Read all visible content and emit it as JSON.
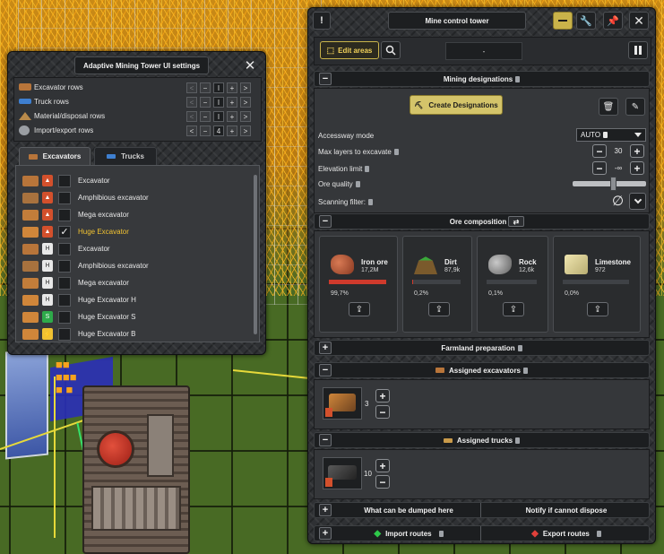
{
  "settings_panel": {
    "title": "Adaptive Mining Tower UI settings",
    "rows": [
      {
        "label": "Excavator rows",
        "value": "I"
      },
      {
        "label": "Truck rows",
        "value": "I"
      },
      {
        "label": "Material/disposal rows",
        "value": "I"
      },
      {
        "label": "Import/export rows",
        "value": "4"
      }
    ],
    "tabs": [
      {
        "label": "Excavators",
        "active": true
      },
      {
        "label": "Trucks",
        "active": false
      }
    ],
    "vehicles": [
      {
        "name": "Excavator",
        "checked": false,
        "fuel": "diesel",
        "selected": false
      },
      {
        "name": "Amphibious excavator",
        "checked": false,
        "fuel": "diesel",
        "selected": false
      },
      {
        "name": "Mega excavator",
        "checked": false,
        "fuel": "diesel",
        "selected": false
      },
      {
        "name": "Huge Excavator",
        "checked": true,
        "fuel": "diesel",
        "selected": true
      },
      {
        "name": "Excavator",
        "checked": false,
        "fuel": "hydrogen",
        "selected": false
      },
      {
        "name": "Amphibious excavator",
        "checked": false,
        "fuel": "hydrogen",
        "selected": false
      },
      {
        "name": "Mega excavator",
        "checked": false,
        "fuel": "hydrogen",
        "selected": false
      },
      {
        "name": "Huge Excavator H",
        "checked": false,
        "fuel": "hydrogen",
        "selected": false
      },
      {
        "name": "Huge Excavator S",
        "checked": false,
        "fuel": "green",
        "selected": false
      },
      {
        "name": "Huge Excavator B",
        "checked": false,
        "fuel": "battery",
        "selected": false
      }
    ]
  },
  "tower_panel": {
    "title": "Mine control tower",
    "edit_areas_label": "Edit areas",
    "status_value": "-",
    "mining": {
      "header": "Mining designations",
      "create_label": "Create Designations",
      "accessway_label": "Accessway mode",
      "accessway_value": "AUTO",
      "max_layers_label": "Max layers to excavate",
      "max_layers_value": "30",
      "elevation_label": "Elevation limit",
      "elevation_value": "-∞",
      "ore_quality_label": "Ore quality",
      "ore_quality_level": 0.55,
      "scanning_label": "Scanning filter:"
    },
    "ore_composition": {
      "header": "Ore composition",
      "ores": [
        {
          "name": "Iron ore",
          "amount": "17,2M",
          "percent": "99,7%",
          "fraction": 0.997,
          "color": "#b65a3c"
        },
        {
          "name": "Dirt",
          "amount": "87,9k",
          "percent": "0,2%",
          "fraction": 0.002,
          "color": "#7a5a2c"
        },
        {
          "name": "Rock",
          "amount": "12,6k",
          "percent": "0,1%",
          "fraction": 0.001,
          "color": "#8c8c8c"
        },
        {
          "name": "Limestone",
          "amount": "972",
          "percent": "0,0%",
          "fraction": 0.0,
          "color": "#d8cf96"
        }
      ]
    },
    "farmland_header": "Farmland preparation",
    "assigned_excavators": {
      "header": "Assigned excavators",
      "count": "3"
    },
    "assigned_trucks": {
      "header": "Assigned trucks",
      "count": "10"
    },
    "dump_label": "What can be dumped here",
    "notify_label": "Notify if cannot dispose",
    "import_label": "Import routes",
    "export_label": "Export routes"
  }
}
